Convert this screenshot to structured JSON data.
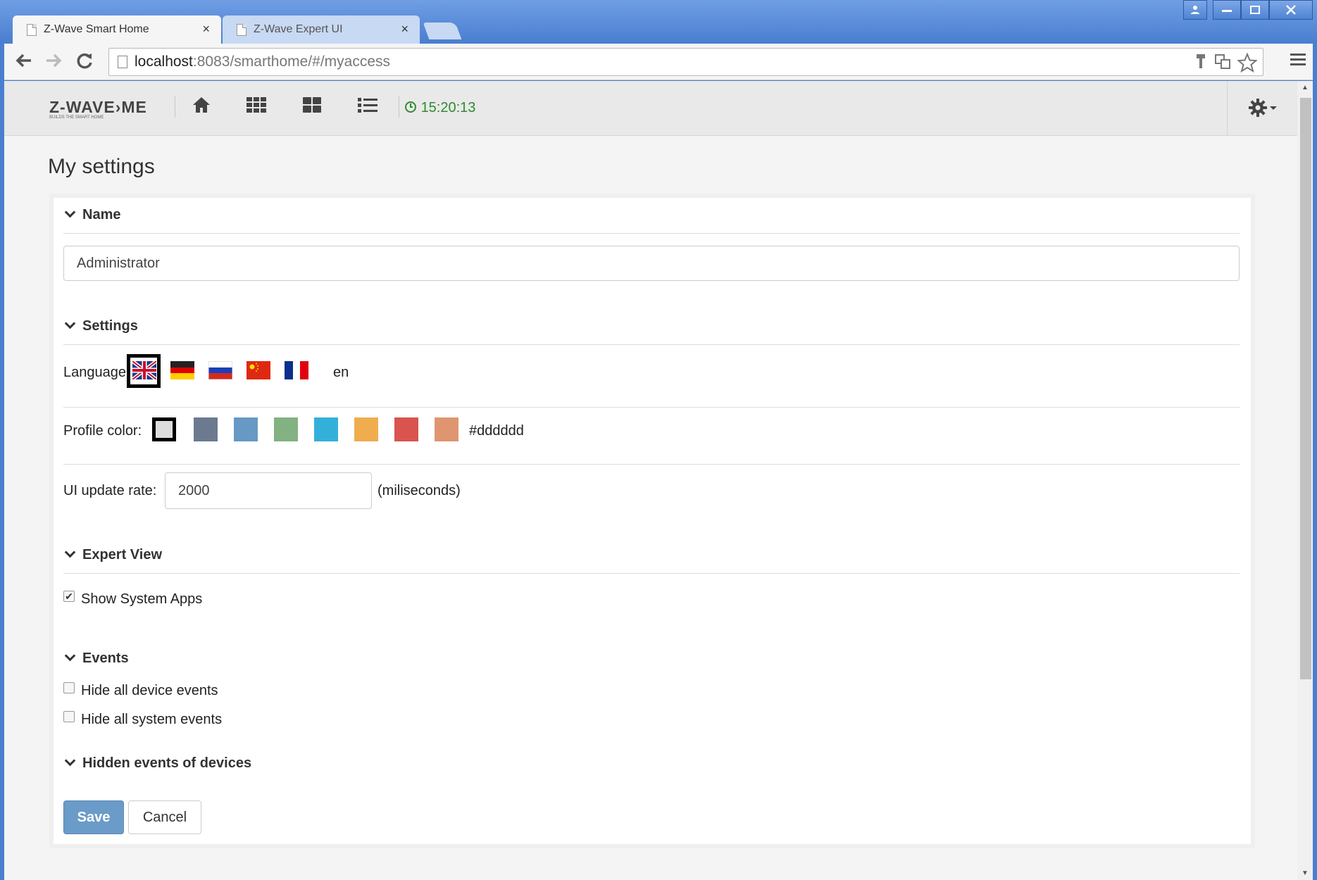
{
  "browser": {
    "tabs": [
      {
        "label": "Z-Wave Smart Home"
      },
      {
        "label": "Z-Wave Expert UI"
      }
    ],
    "close_glyph": "×",
    "address": {
      "host": "localhost",
      "path": ":8083/smarthome/#/myaccess"
    }
  },
  "app": {
    "logo_text": "Z-WAVE›ME",
    "logo_tagline": "BUILDS THE SMART HOME",
    "clock": "15:20:13",
    "nav_icons": [
      "home-icon",
      "grid-icon",
      "dashboard-icon",
      "list-icon"
    ]
  },
  "page": {
    "title": "My settings",
    "sections": {
      "name": "Name",
      "settings": "Settings",
      "expert": "Expert View",
      "events": "Events",
      "hidden": "Hidden events of devices"
    },
    "name_value": "Administrator",
    "language_label": "Language:",
    "language_value": "en",
    "languages": [
      "en",
      "de",
      "ru",
      "cn",
      "fr"
    ],
    "profile_color_label": "Profile color:",
    "profile_color_value": "#dddddd",
    "profile_colors": [
      "#dddddd",
      "#6b7a8f",
      "#6699c4",
      "#82b182",
      "#33b0d9",
      "#f0ad4e",
      "#d9534f",
      "#df9670"
    ],
    "update_rate_label": "UI update rate:",
    "update_rate_value": "2000",
    "update_rate_unit": "(miliseconds)",
    "show_system_apps": "Show System Apps",
    "hide_device_events": "Hide all device events",
    "hide_system_events": "Hide all system events",
    "save": "Save",
    "cancel": "Cancel"
  }
}
